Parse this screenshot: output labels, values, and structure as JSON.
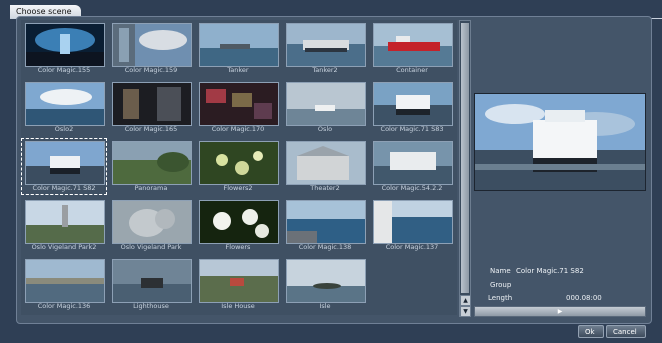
{
  "window": {
    "title": "Choose scene"
  },
  "scenes": [
    {
      "label": "Color Magic.155"
    },
    {
      "label": "Color Magic.159"
    },
    {
      "label": "Tanker"
    },
    {
      "label": "Tanker2"
    },
    {
      "label": "Container"
    },
    {
      "label": "Oslo2"
    },
    {
      "label": "Color Magic.165"
    },
    {
      "label": "Color Magic.170"
    },
    {
      "label": "Oslo"
    },
    {
      "label": "Color Magic.71 S83"
    },
    {
      "label": "Color Magic.71 S82",
      "selected": true
    },
    {
      "label": "Panorama"
    },
    {
      "label": "Flowers2"
    },
    {
      "label": "Theater2"
    },
    {
      "label": "Color Magic.54.2.2"
    },
    {
      "label": "Oslo Vigeland Park2"
    },
    {
      "label": "Oslo Vigeland Park"
    },
    {
      "label": "Flowers"
    },
    {
      "label": "Color Magic.138"
    },
    {
      "label": "Color Magic.137"
    },
    {
      "label": "Color Magic.136"
    },
    {
      "label": "Lighthouse"
    },
    {
      "label": "Isle House"
    },
    {
      "label": "Isle"
    }
  ],
  "details": {
    "name_label": "Name",
    "name_value": "Color Magic.71 S82",
    "group_label": "Group",
    "group_value": "",
    "length_label": "Length",
    "length_value": "000.08:00"
  },
  "scroll": {
    "up_icon": "▲",
    "down_icon": "▼"
  },
  "playback": {
    "play_icon": "▶"
  },
  "buttons": {
    "ok": "Ok",
    "cancel": "Cancel"
  }
}
